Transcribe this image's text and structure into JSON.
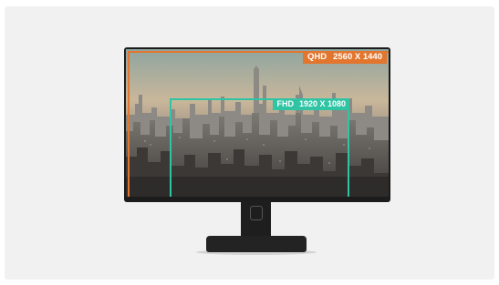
{
  "qhd": {
    "label": "QHD",
    "resolution": "2560 X 1440",
    "color": "#e2762e"
  },
  "fhd": {
    "label": "FHD",
    "resolution": "1920 X 1080",
    "color": "#2ec4a4"
  },
  "scene": "city-skyline-photo",
  "colors": {
    "background": "#f1f1f1",
    "bezel": "#1c1c1c",
    "stand": "#232323"
  }
}
